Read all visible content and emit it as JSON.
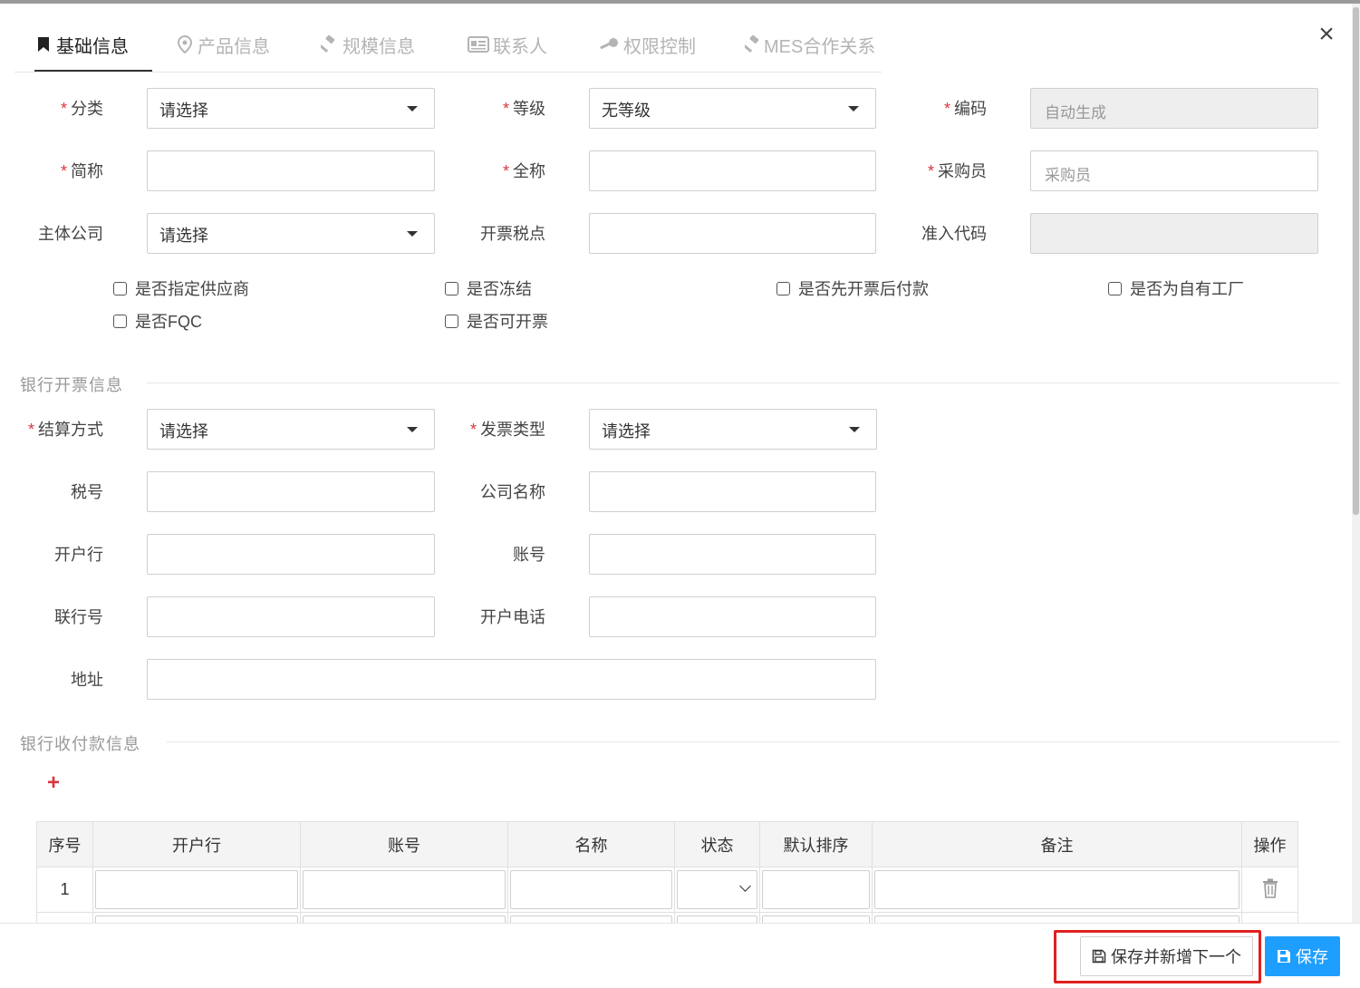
{
  "tabs": [
    {
      "label": "基础信息",
      "icon": "bookmark-icon",
      "active": true
    },
    {
      "label": "产品信息",
      "icon": "map-pin-icon"
    },
    {
      "label": "规模信息",
      "icon": "gavel-icon"
    },
    {
      "label": "联系人",
      "icon": "id-card-icon"
    },
    {
      "label": "权限控制",
      "icon": "key-icon"
    },
    {
      "label": "MES合作关系",
      "icon": "gavel-icon"
    }
  ],
  "basic": {
    "category_label": "分类",
    "category_value": "请选择",
    "level_label": "等级",
    "level_value": "无等级",
    "code_label": "编码",
    "code_placeholder": "自动生成",
    "short_name_label": "简称",
    "full_name_label": "全称",
    "buyer_label": "采购员",
    "buyer_placeholder": "采购员",
    "company_label": "主体公司",
    "company_value": "请选择",
    "tax_point_label": "开票税点",
    "access_code_label": "准入代码"
  },
  "checkboxes": [
    "是否指定供应商",
    "是否冻结",
    "是否先开票后付款",
    "是否为自有工厂",
    "是否FQC",
    "是否可开票"
  ],
  "bank_invoice": {
    "section_title": "银行开票信息",
    "settlement_label": "结算方式",
    "settlement_value": "请选择",
    "invoice_type_label": "发票类型",
    "invoice_type_value": "请选择",
    "tax_no_label": "税号",
    "company_name_label": "公司名称",
    "bank_label": "开户行",
    "account_label": "账号",
    "bank_code_label": "联行号",
    "phone_label": "开户电话",
    "address_label": "地址"
  },
  "bank_payment": {
    "section_title": "银行收付款信息",
    "add_icon": "plus-icon",
    "columns": [
      "序号",
      "开户行",
      "账号",
      "名称",
      "状态",
      "默认排序",
      "备注",
      "操作"
    ],
    "rows": [
      {
        "index": "1"
      }
    ]
  },
  "footer": {
    "save_and_new_label": "保存并新增下一个",
    "save_label": "保存"
  },
  "colors": {
    "primary": "#1e9fff",
    "required": "#d9363e",
    "highlight": "#e02020"
  }
}
